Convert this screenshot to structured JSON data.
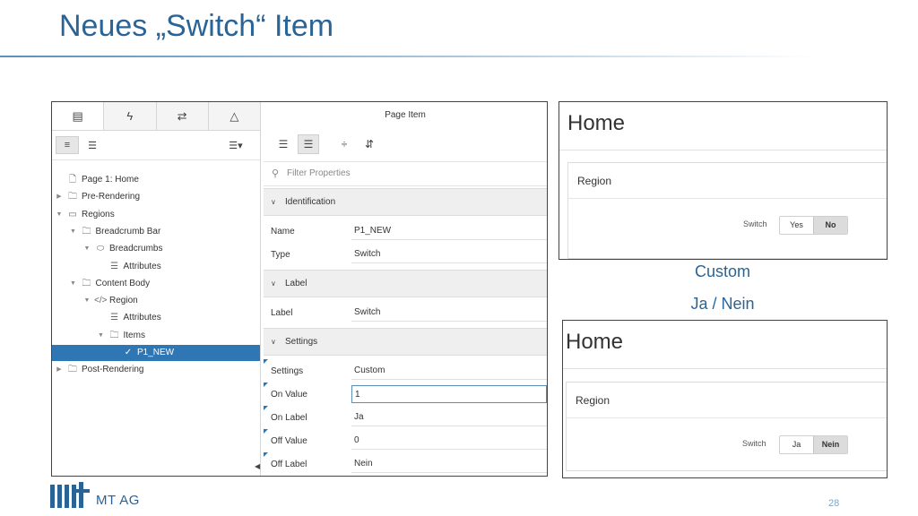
{
  "slide": {
    "title": "Neues „Switch“ Item",
    "page_number": "28",
    "logo_text": "MT AG"
  },
  "builder": {
    "tabs": [
      {
        "icon": "rendering-tree-icon"
      },
      {
        "icon": "dynamic-actions-icon"
      },
      {
        "icon": "processing-icon"
      },
      {
        "icon": "shared-components-icon"
      }
    ],
    "tree": [
      {
        "label": "Page 1: Home",
        "icon": "page-icon",
        "level": 0,
        "twisty": ""
      },
      {
        "label": "Pre-Rendering",
        "icon": "folder-icon",
        "level": 0,
        "twisty": "collapsed"
      },
      {
        "label": "Regions",
        "icon": "region-icon",
        "level": 0,
        "twisty": "expanded"
      },
      {
        "label": "Breadcrumb Bar",
        "icon": "folder-icon",
        "level": 1,
        "twisty": "expanded"
      },
      {
        "label": "Breadcrumbs",
        "icon": "breadcrumb-icon",
        "level": 2,
        "twisty": "expanded"
      },
      {
        "label": "Attributes",
        "icon": "attributes-icon",
        "level": 3,
        "twisty": ""
      },
      {
        "label": "Content Body",
        "icon": "folder-icon",
        "level": 1,
        "twisty": "expanded"
      },
      {
        "label": "Region",
        "icon": "code-icon",
        "level": 2,
        "twisty": "expanded"
      },
      {
        "label": "Attributes",
        "icon": "attributes-icon",
        "level": 3,
        "twisty": ""
      },
      {
        "label": "Items",
        "icon": "folder-icon",
        "level": 3,
        "twisty": "expanded"
      },
      {
        "label": "P1_NEW",
        "icon": "switch-item-icon",
        "level": 4,
        "twisty": "",
        "selected": true
      },
      {
        "label": "Post-Rendering",
        "icon": "folder-icon",
        "level": 0,
        "twisty": "collapsed"
      }
    ],
    "props": {
      "header": "Page Item",
      "filter_placeholder": "Filter Properties",
      "groups": [
        {
          "title": "Identification",
          "rows": [
            {
              "label": "Name",
              "value": "P1_NEW"
            },
            {
              "label": "Type",
              "value": "Switch"
            }
          ]
        },
        {
          "title": "Label",
          "rows": [
            {
              "label": "Label",
              "value": "Switch"
            }
          ]
        },
        {
          "title": "Settings",
          "rows": [
            {
              "label": "Settings",
              "value": "Custom"
            },
            {
              "label": "On Value",
              "value": "1"
            },
            {
              "label": "On Label",
              "value": "Ja"
            },
            {
              "label": "Off Value",
              "value": "0"
            },
            {
              "label": "Off Label",
              "value": "Nein"
            }
          ]
        }
      ]
    }
  },
  "preview_top": {
    "page_title": "Home",
    "region_title": "Region",
    "switch_label": "Switch",
    "options": [
      {
        "label": "Yes",
        "active": false
      },
      {
        "label": "No",
        "active": true
      }
    ]
  },
  "preview_bottom": {
    "page_title": "Home",
    "region_title": "Region",
    "switch_label": "Switch",
    "options": [
      {
        "label": "Ja",
        "active": false
      },
      {
        "label": "Nein",
        "active": true
      }
    ]
  },
  "captions": {
    "custom": "Custom",
    "ja_nein": "Ja / Nein"
  },
  "colors": {
    "accent": "#2a6496",
    "selection": "#2f76b5"
  }
}
